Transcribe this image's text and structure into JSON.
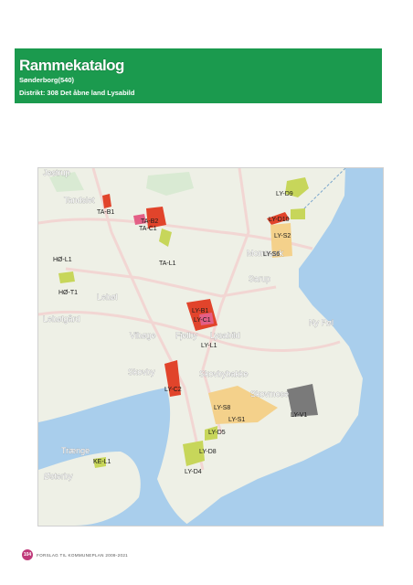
{
  "header": {
    "title": "Rammekatalog",
    "subtitle": "Sønderborg(540)",
    "district": "Distrikt: 308 Det åbne land Lysabild"
  },
  "map": {
    "place_names": [
      "Jestrup",
      "Tandslet",
      "Mommark",
      "Sarup",
      "Lebøl",
      "Lebølgård",
      "Vibøge",
      "Fjelby",
      "Lysabild",
      "Ny Pøl",
      "Skovby",
      "Skovbybakke",
      "Skovmose",
      "Trænge",
      "Østerby",
      "Asserballe"
    ],
    "zone_labels": [
      "LY-D9",
      "LY-D10",
      "LY-S2",
      "LY-S6",
      "TA-B1",
      "TA-B2",
      "TA-C1",
      "TA-L1",
      "HØ-L1",
      "HØ-T1",
      "LY-B1",
      "LY-C1",
      "LY-L1",
      "LY-C2",
      "LY-S8",
      "LY-S1",
      "LY-D5",
      "LY-V1",
      "LY-D8",
      "LY-D4",
      "KE-L1"
    ],
    "colors": {
      "sea": "#a9ceec",
      "land": "#eef0e6",
      "boligzone": "#e1442b",
      "centerzone": "#e35f86",
      "sommerhus": "#f4d18b",
      "fritid": "#c7d65a",
      "virksomhed": "#7a7a7a"
    }
  },
  "footer": {
    "page_number": "104",
    "text": "FORSLAG TIL KOMMUNEPLAN 2009-2021"
  }
}
